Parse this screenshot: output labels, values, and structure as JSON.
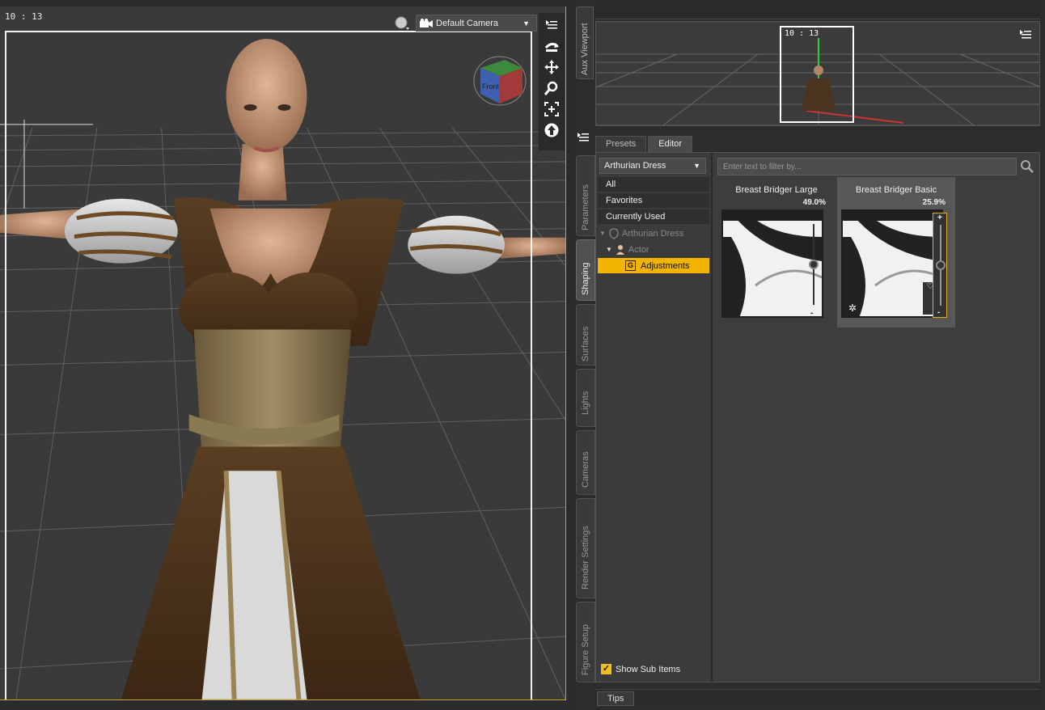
{
  "viewport": {
    "time": "10 : 13",
    "camera": "Default Camera",
    "view_cube_label": "Front"
  },
  "aux": {
    "tab_label": "Aux Viewport",
    "time": "10 : 13"
  },
  "side_tabs": [
    "Parameters",
    "Shaping",
    "Surfaces",
    "Lights",
    "Cameras",
    "Render Settings",
    "Figure Setup"
  ],
  "pane_tabs": [
    "Presets",
    "Editor"
  ],
  "node_select": "Arthurian Dress",
  "list": [
    "All",
    "Favorites",
    "Currently Used"
  ],
  "tree": {
    "root": "Arthurian Dress",
    "actor": "Actor",
    "group_icon": "G",
    "selected": "Adjustments"
  },
  "filter_placeholder": "Enter text to filter by...",
  "cards": [
    {
      "title": "Breast Bridger Large",
      "value": "49.0%"
    },
    {
      "title": "Breast Bridger Basic",
      "value": "25.9%"
    }
  ],
  "show_sub_items": "Show Sub Items",
  "tips": "Tips",
  "colors": {
    "accent": "#f2b400",
    "panel": "#3d3d3d"
  }
}
